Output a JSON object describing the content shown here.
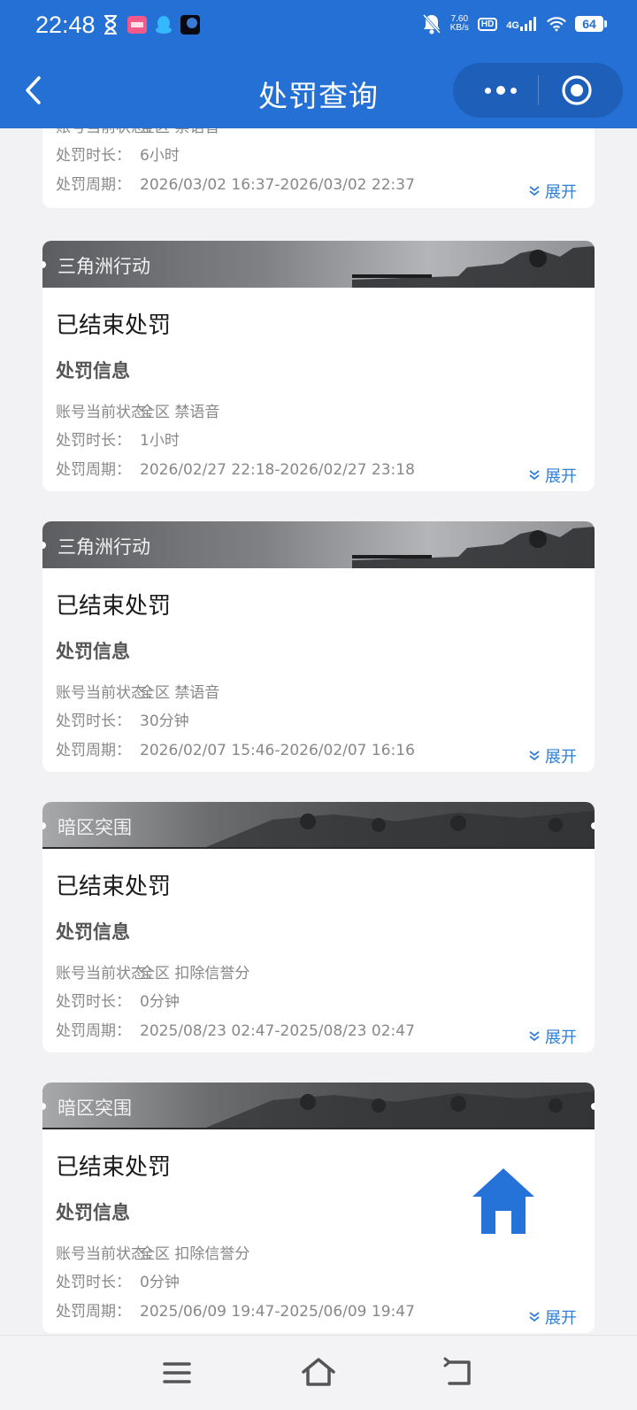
{
  "status_bar": {
    "time": "22:48",
    "net_speed_value": "7.60",
    "net_speed_unit": "KB/s",
    "hd": "HD",
    "signal": "4G",
    "battery": "64"
  },
  "nav": {
    "title": "处罚查询"
  },
  "labels": {
    "section_title": "处罚信息",
    "status_label": "账号当前状态：",
    "duration_label": "处罚时长：",
    "period_label": "处罚周期：",
    "expand": "展开"
  },
  "partial_card": {
    "status_value": "全区 禁语音",
    "duration": "6小时",
    "period": "2026/03/02 16:37-2026/03/02 22:37"
  },
  "cards": [
    {
      "game": "三角洲行动",
      "status": "已结束处罚",
      "account_state": "全区 禁语音",
      "duration": "1小时",
      "period": "2026/02/27 22:18-2026/02/27 23:18"
    },
    {
      "game": "三角洲行动",
      "status": "已结束处罚",
      "account_state": "全区 禁语音",
      "duration": "30分钟",
      "period": "2026/02/07 15:46-2026/02/07 16:16"
    },
    {
      "game": "暗区突围",
      "status": "已结束处罚",
      "account_state": "全区 扣除信誉分",
      "duration": "0分钟",
      "period": "2025/08/23 02:47-2025/08/23 02:47"
    },
    {
      "game": "暗区突围",
      "status": "已结束处罚",
      "account_state": "全区 扣除信誉分",
      "duration": "0分钟",
      "period": "2025/06/09 19:47-2025/06/09 19:47"
    }
  ],
  "colors": {
    "primary": "#2570d4",
    "link": "#2f7fd8",
    "background": "#f2f2f4"
  }
}
